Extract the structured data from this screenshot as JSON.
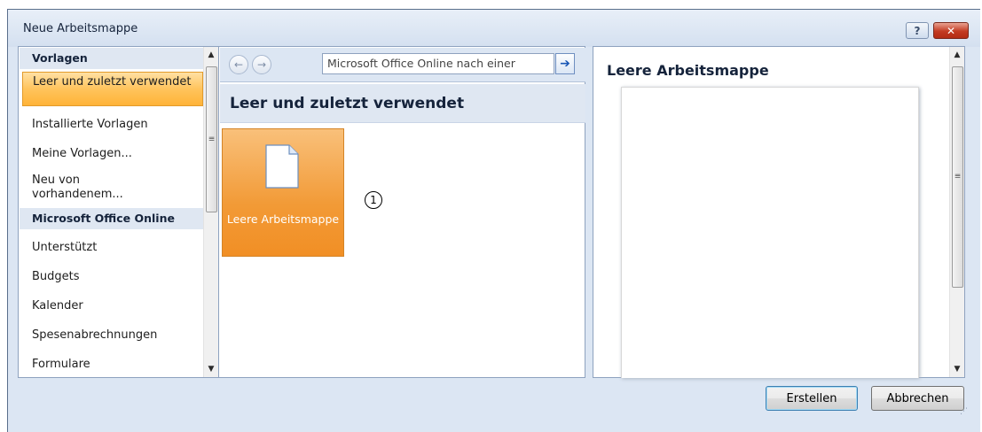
{
  "window": {
    "title": "Neue Arbeitsmappe",
    "help_label": "?",
    "close_label": "✕"
  },
  "sidebar": {
    "header_templates": "Vorlagen",
    "header_online": "Microsoft Office Online",
    "items": [
      {
        "label": "Leer und zuletzt verwendet",
        "selected": true
      },
      {
        "label": "Installierte Vorlagen"
      },
      {
        "label": "Meine Vorlagen..."
      },
      {
        "label": "Neu von vorhandenem..."
      },
      {
        "label": "Unterstützt"
      },
      {
        "label": "Budgets"
      },
      {
        "label": "Kalender"
      },
      {
        "label": "Spesenabrechnungen"
      },
      {
        "label": "Formulare"
      }
    ]
  },
  "nav": {
    "search_text": "Microsoft Office Online nach einer",
    "back_icon": "back-arrow-icon",
    "forward_icon": "forward-arrow-icon",
    "go_icon": "go-arrow-icon"
  },
  "main": {
    "section_title": "Leer und zuletzt verwendet",
    "template_label": "Leere Arbeitsmappe",
    "marker": "1"
  },
  "preview": {
    "title": "Leere Arbeitsmappe"
  },
  "buttons": {
    "create": "Erstellen",
    "cancel": "Abbrechen"
  },
  "colors": {
    "accent_orange": "#f29a36",
    "header_blue": "#dfe7f2",
    "title_text": "#15233b"
  }
}
